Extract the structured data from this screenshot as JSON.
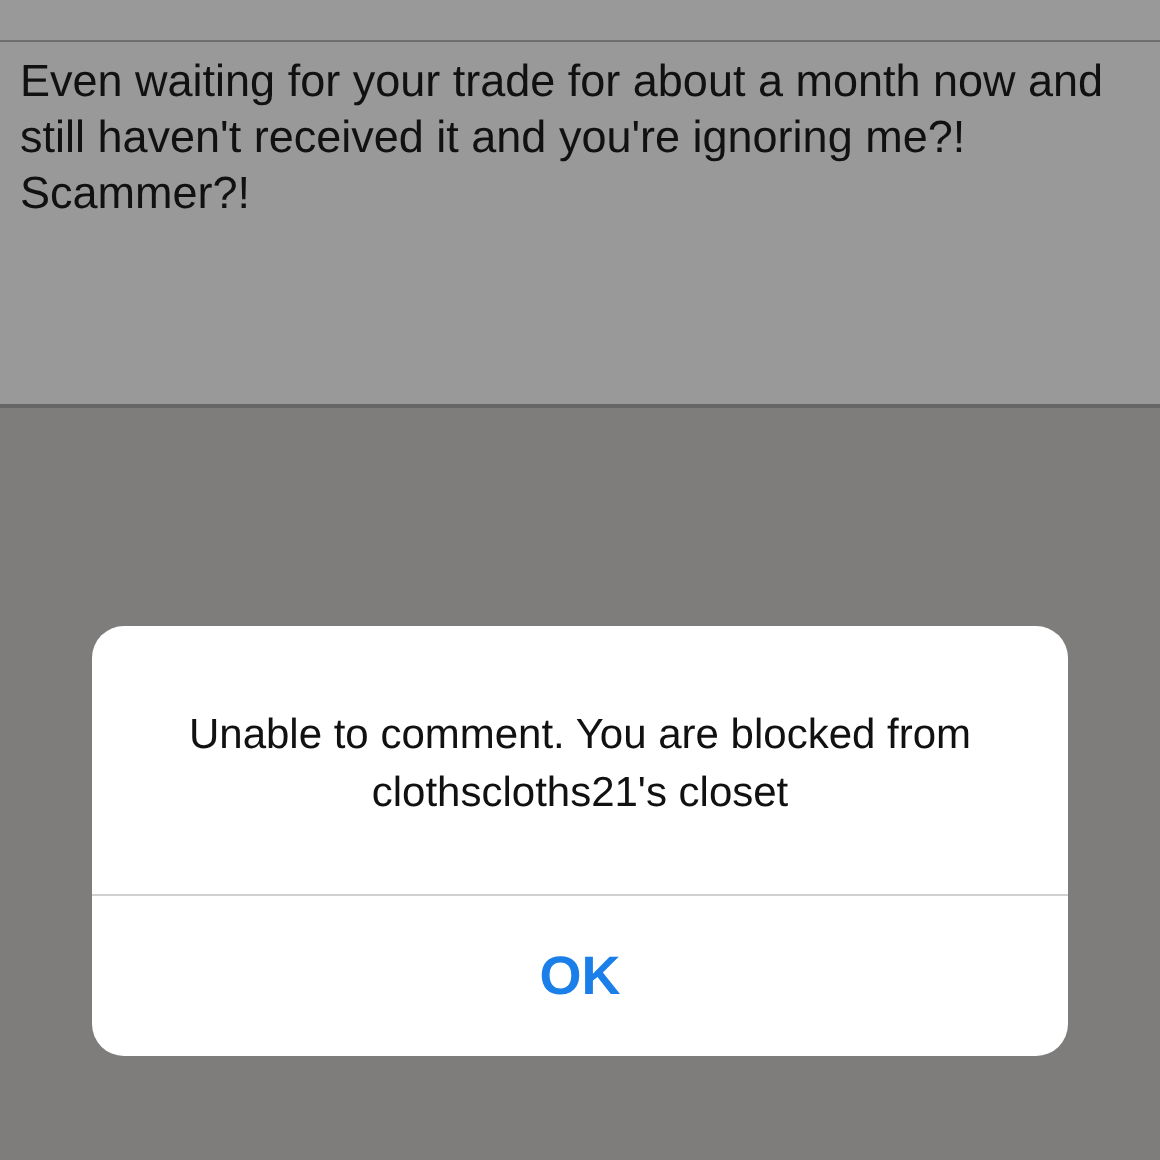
{
  "comment": {
    "text": "Even waiting for your trade for about a month now and still haven't received it and you're ignoring me?! Scammer?!"
  },
  "alert": {
    "message": "Unable to comment. You are blocked from clothscloths21's closet",
    "button": "OK"
  }
}
